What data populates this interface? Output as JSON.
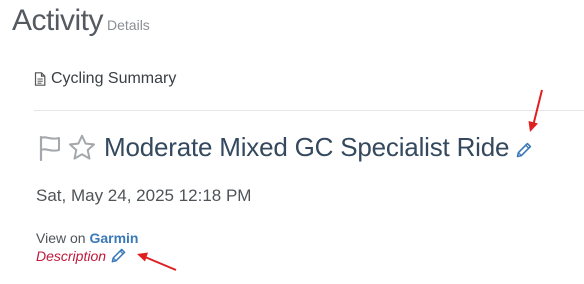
{
  "header": {
    "title": "Activity",
    "subtitle": "Details"
  },
  "summary_tab": {
    "label": "Cycling Summary",
    "icon": "document-icon"
  },
  "ride": {
    "title": "Moderate Mixed GC Specialist Ride",
    "date": "Sat, May 24, 2025 12:18 PM",
    "icons": [
      "flag-icon",
      "star-icon",
      "pencil-icon"
    ]
  },
  "source": {
    "prefix": "View on",
    "link_label": "Garmin"
  },
  "description": {
    "label": "Description",
    "icon": "pencil-icon"
  },
  "colors": {
    "title": "#34495e",
    "link": "#3a79b8",
    "description": "#c0193b",
    "annotation_arrow": "#e02020",
    "pencil": "#3a79b8"
  }
}
